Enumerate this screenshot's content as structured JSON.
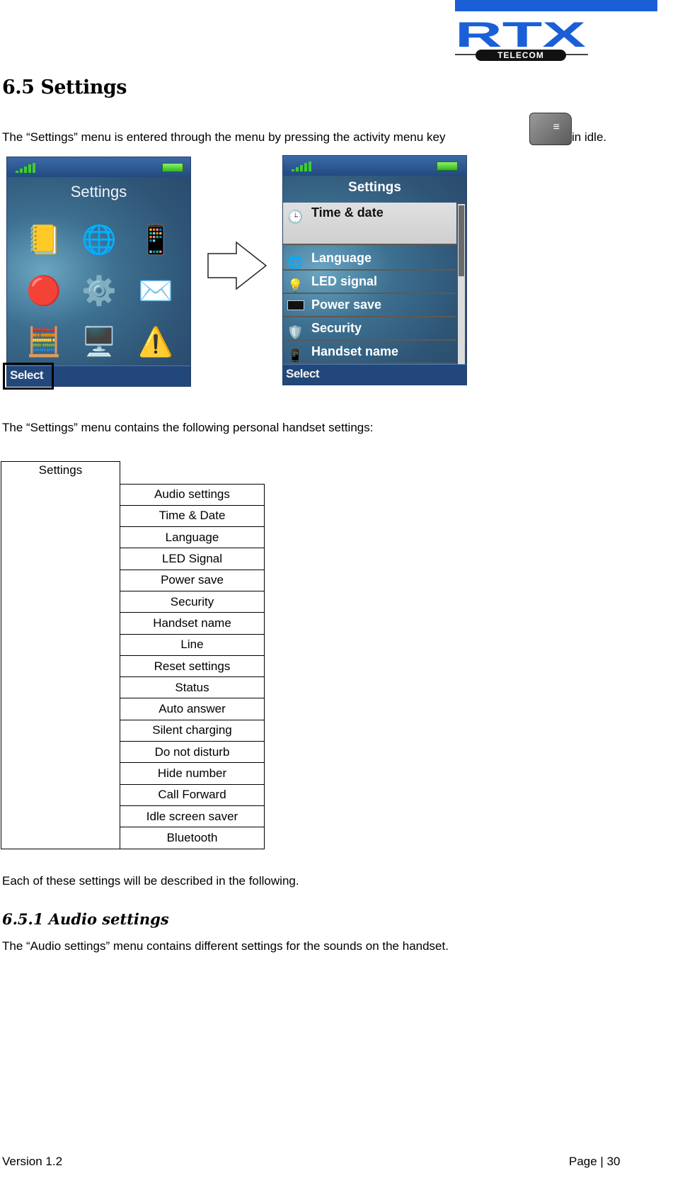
{
  "logo": {
    "brand": "RTX",
    "sub": "TELECOM",
    "color": "#1a5fd6"
  },
  "heading": "6.5 Settings",
  "intro": {
    "before_icon": "The “Settings” menu is entered through the menu by pressing the activity menu key",
    "after_icon": "in idle.",
    "key_icon": "menu-key-icon"
  },
  "screen_left": {
    "title": "Settings",
    "icons": [
      "phonebook-icon",
      "globe-icon",
      "handset-icon",
      "network-icon",
      "gear-icon",
      "envelope-icon",
      "calculator-stopwatch-icon",
      "monitor-icon",
      "warning-icon"
    ],
    "softkey": "Select"
  },
  "screen_right": {
    "title": "Settings",
    "items": [
      {
        "label": "Time & date",
        "icon": "clock-icon",
        "selected": true
      },
      {
        "label": "Language",
        "icon": "globe-icon"
      },
      {
        "label": "LED signal",
        "icon": "led-icon"
      },
      {
        "label": "Power save",
        "icon": "screen-icon"
      },
      {
        "label": "Security",
        "icon": "shield-icon"
      },
      {
        "label": "Handset name",
        "icon": "handset-icon"
      }
    ],
    "softkey": "Select"
  },
  "para2": "The “Settings” menu contains the following personal handset settings:",
  "table": {
    "root": "Settings",
    "items": [
      "Audio settings",
      "Time & Date",
      "Language",
      "LED Signal",
      "Power save",
      "Security",
      "Handset name",
      "Line",
      "Reset settings",
      "Status",
      "Auto answer",
      "Silent charging",
      "Do not disturb",
      "Hide number",
      "Call Forward",
      "Idle screen saver",
      "Bluetooth"
    ]
  },
  "para3": "Each of these settings will be described in the following.",
  "subheading": "6.5.1 Audio settings",
  "para4": "The “Audio settings” menu contains different settings for the sounds on the handset.",
  "footer": {
    "version": "Version 1.2",
    "page": "Page | 30"
  }
}
